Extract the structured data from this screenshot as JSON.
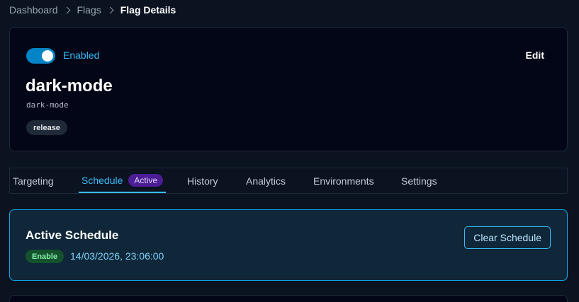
{
  "breadcrumb": {
    "items": [
      "Dashboard",
      "Flags",
      "Flag Details"
    ]
  },
  "flag": {
    "enabled": true,
    "status_label": "Enabled",
    "edit_label": "Edit",
    "name": "dark-mode",
    "key": "dark-mode",
    "tag": "release"
  },
  "tabs": {
    "items": [
      {
        "label": "Targeting"
      },
      {
        "label": "Schedule",
        "badge": "Active",
        "active": true
      },
      {
        "label": "History"
      },
      {
        "label": "Analytics"
      },
      {
        "label": "Environments"
      },
      {
        "label": "Settings"
      }
    ]
  },
  "schedule": {
    "title": "Active Schedule",
    "action": "Enable",
    "datetime": "14/03/2026, 23:06:00",
    "clear_label": "Clear Schedule"
  },
  "colors": {
    "background": "#0b1220",
    "card": "#020617",
    "accent": "#38bdf8",
    "toggle_on": "#0284c7",
    "active_badge": "#4c1d95",
    "enable_badge": "#14532d"
  }
}
